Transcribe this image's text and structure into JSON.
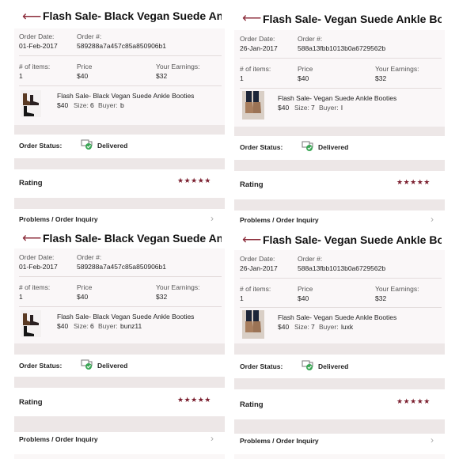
{
  "labels": {
    "order_date": "Order Date:",
    "order_num": "Order #:",
    "items": "# of items:",
    "price": "Price",
    "earnings": "Your Earnings:",
    "order_status": "Order Status:",
    "rating": "Rating",
    "problems": "Problems / Order Inquiry",
    "size_prefix": "Size:",
    "buyer_prefix": "Buyer:"
  },
  "icons": {
    "back": "back-arrow-icon",
    "status": "delivered-truck-check-icon",
    "chevron": "chevron-right-icon",
    "star": "star-icon"
  },
  "colors": {
    "accent": "#7b1f2f",
    "check": "#3aa655"
  },
  "stars": "★★★★★",
  "panels": [
    {
      "title": "Flash Sale- Black Vegan Suede Ankl...",
      "order_date": "01-Feb-2017",
      "order_num": "589288a7a457c85a850906b1",
      "items": "1",
      "price": "$40",
      "earnings": "$32",
      "product_name": "Flash Sale- Black Vegan Suede Ankle Booties",
      "product_price": "$40",
      "size": "6",
      "buyer": "b",
      "status": "Delivered"
    },
    {
      "title": "Flash Sale- Vegan Suede Ankle Bootie",
      "order_date": "26-Jan-2017",
      "order_num": "588a13fbb1013b0a6729562b",
      "items": "1",
      "price": "$40",
      "earnings": "$32",
      "product_name": "Flash Sale- Vegan Suede Ankle Booties",
      "product_price": "$40",
      "size": "7",
      "buyer": "l",
      "status": "Delivered"
    },
    {
      "title": "Flash Sale- Black Vegan Suede Ankl...",
      "order_date": "01-Feb-2017",
      "order_num": "589288a7a457c85a850906b1",
      "items": "1",
      "price": "$40",
      "earnings": "$32",
      "product_name": "Flash Sale- Black Vegan Suede Ankle Booties",
      "product_price": "$40",
      "size": "6",
      "buyer": "bunz11",
      "status": "Delivered"
    },
    {
      "title": "Flash Sale- Vegan Suede Ankle Bootie",
      "order_date": "26-Jan-2017",
      "order_num": "588a13fbb1013b0a6729562b",
      "items": "1",
      "price": "$40",
      "earnings": "$32",
      "product_name": "Flash Sale- Vegan Suede Ankle Booties",
      "product_price": "$40",
      "size": "7",
      "buyer": "luxk",
      "status": "Delivered"
    }
  ]
}
